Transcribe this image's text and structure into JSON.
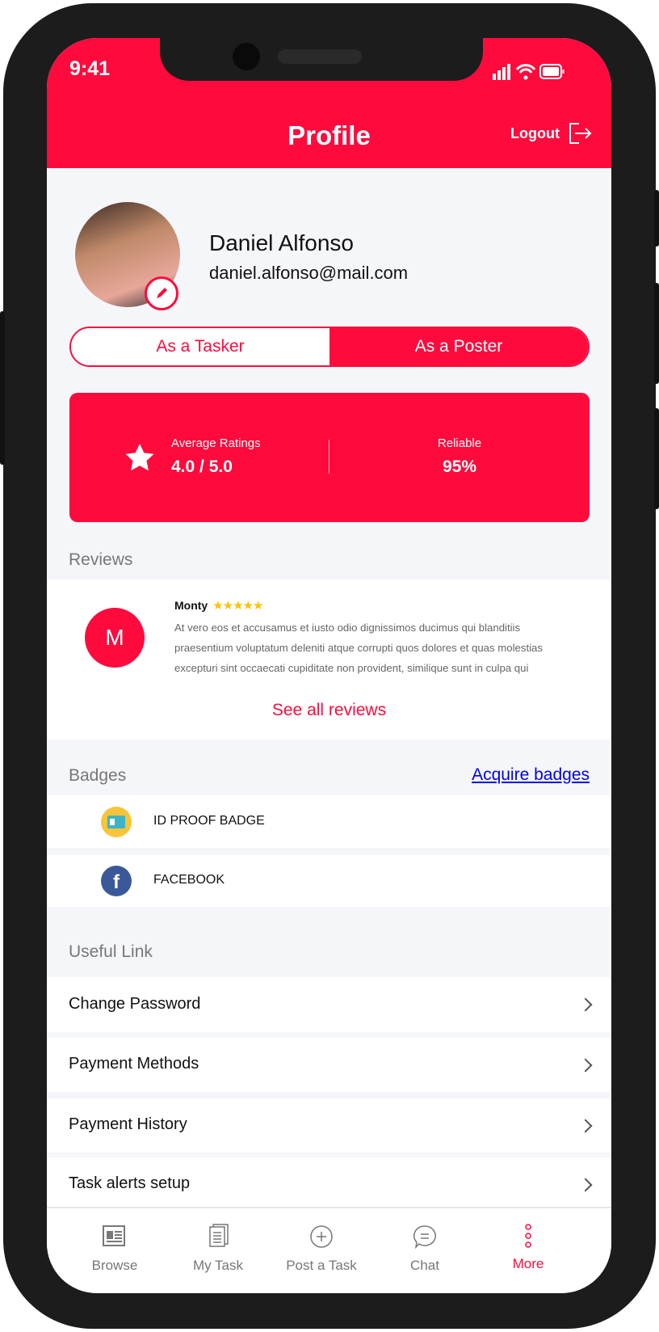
{
  "status": {
    "time": "9:41"
  },
  "header": {
    "title": "Profile",
    "logout": "Logout"
  },
  "profile": {
    "name": "Daniel Alfonso",
    "email": "daniel.alfonso@mail.com"
  },
  "toggle": {
    "tasker": "As a Tasker",
    "poster": "As a Poster",
    "selected": "As a Poster"
  },
  "stats": {
    "rating_label": "Average Ratings",
    "rating_value": "4.0 / 5.0",
    "reliable_label": "Reliable",
    "reliable_value": "95%"
  },
  "reviews": {
    "title": "Reviews",
    "items": [
      {
        "initial": "M",
        "name": "Monty",
        "stars": 5,
        "text": [
          "At vero eos et accusamus et iusto odio dignissimos ducimus qui blanditiis",
          "praesentium voluptatum deleniti atque corrupti quos dolores et quas molestias",
          "excepturi sint occaecati cupiditate non provident, similique sunt in culpa qui"
        ]
      }
    ],
    "see_all": "See all reviews"
  },
  "badges": {
    "title": "Badges",
    "acquire": "Acquire badges",
    "items": [
      {
        "label": "ID PROOF BADGE",
        "icon": "id-card-icon"
      },
      {
        "label": "FACEBOOK",
        "icon": "facebook-icon"
      }
    ]
  },
  "links": {
    "title": "Useful Link",
    "items": [
      {
        "label": "Change Password"
      },
      {
        "label": "Payment Methods"
      },
      {
        "label": "Payment History"
      },
      {
        "label": "Task alerts setup"
      }
    ]
  },
  "tabbar": {
    "items": [
      {
        "label": "Browse",
        "icon": "newspaper-icon"
      },
      {
        "label": "My Task",
        "icon": "documents-icon"
      },
      {
        "label": "Post a Task",
        "icon": "plus-circle-icon"
      },
      {
        "label": "Chat",
        "icon": "chat-bubble-icon"
      },
      {
        "label": "More",
        "icon": "more-vertical-icon",
        "active": true
      }
    ]
  },
  "colors": {
    "accent": "#ff0a3c",
    "star": "#ffc107",
    "link": "#0000ee"
  }
}
